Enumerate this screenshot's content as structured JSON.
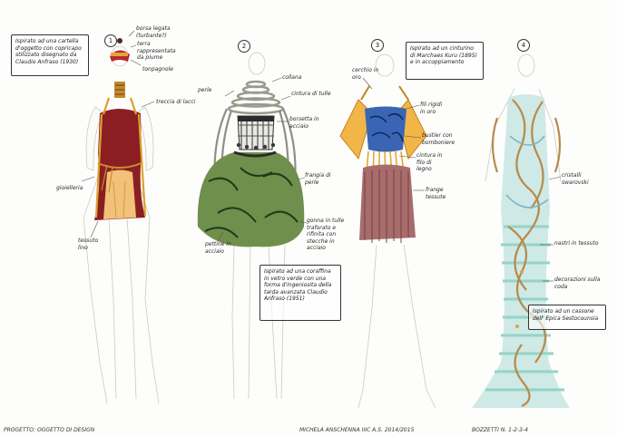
{
  "boxes": {
    "b1": "Ispirato ad una cartella d'oggetto con copricapo stilizzato disegnato da Claudio Anfraso (1930)",
    "b2": "Ispirato ad una coraffina in vetro verde con una forma d'ingeniosita della tarda avanzata Claudio Anfraso (1951)",
    "b3": "Ispirato ad un cinturino di Marchaes Kuru (1895) e in accoppiamento",
    "b4": "Ispirato ad un cassone dell' Epica Sestocounsia"
  },
  "numbers": [
    "1",
    "2",
    "3",
    "4"
  ],
  "annotations": {
    "a1_1": "borsa legata (turbante?)",
    "a1_2": "terra rappresentata da piume",
    "a1_3": "tonpagnole",
    "a1_4": "treccia di lacci",
    "a1_5": "gioielleria",
    "a1_6": "tessuto lino",
    "a2_1": "collana",
    "a2_2": "perle",
    "a2_3": "cintura di tulle",
    "a2_4": "borsetta in acciaio",
    "a2_5": "frangia di perle",
    "a2_6": "gonna in tulle traforato e rifinita con stecche in acciaio",
    "a2_7": "pettine in acciaio",
    "a3_1": "cerchio in oro",
    "a3_2": "fili rigidi in oro",
    "a3_3": "bustier con bomboniere",
    "a3_4": "cintura in filo di legno",
    "a3_5": "frange tessute",
    "a4_1": "cristalli swarovski",
    "a4_2": "nastri in tessuto",
    "a4_3": "decorazioni sulla coda"
  },
  "footer": {
    "left": "PROGETTO: OGGETTO DI DESIGN",
    "mid": "MICHELA ANSCHENNA  IIIC  A.S. 2014/2015",
    "right": "BOZZETTI N. 1-2-3-4"
  }
}
